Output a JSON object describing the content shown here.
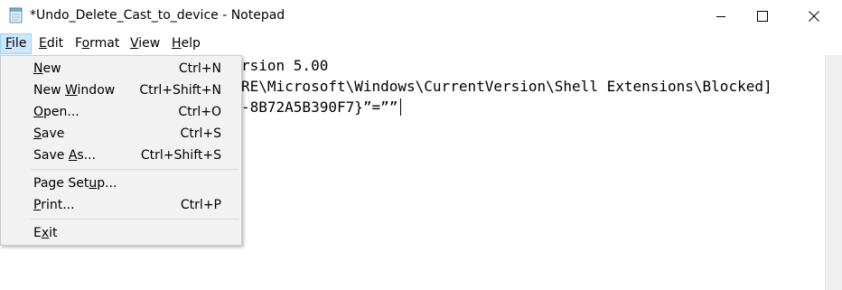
{
  "window": {
    "title": "*Undo_Delete_Cast_to_device - Notepad"
  },
  "controls": {
    "minimize_icon": "minimize-icon",
    "maximize_icon": "maximize-icon",
    "close_icon": "close-icon"
  },
  "menubar": {
    "file": {
      "underlined": "F",
      "rest": "ile"
    },
    "edit": {
      "underlined": "E",
      "rest": "dit"
    },
    "format": {
      "pre": "F",
      "underlined": "o",
      "rest": "rmat"
    },
    "view": {
      "underlined": "V",
      "rest": "iew"
    },
    "help": {
      "underlined": "H",
      "rest": "elp"
    }
  },
  "file_menu": {
    "new": {
      "underlined": "N",
      "rest": "ew",
      "shortcut": "Ctrl+N"
    },
    "new_window": {
      "pre": "New ",
      "underlined": "W",
      "rest": "indow",
      "shortcut": "Ctrl+Shift+N"
    },
    "open": {
      "underlined": "O",
      "rest": "pen...",
      "shortcut": "Ctrl+O"
    },
    "save": {
      "underlined": "S",
      "rest": "ave",
      "shortcut": "Ctrl+S"
    },
    "save_as": {
      "pre": "Save ",
      "underlined": "A",
      "rest": "s...",
      "shortcut": "Ctrl+Shift+S"
    },
    "page_setup": {
      "pre": "Page Set",
      "underlined": "u",
      "rest": "p..."
    },
    "print": {
      "underlined": "P",
      "rest": "rint...",
      "shortcut": "Ctrl+P"
    },
    "exit": {
      "pre": "E",
      "underlined": "x",
      "rest": "it"
    }
  },
  "editor": {
    "line1": "rsion 5.00",
    "line2": "RE\\Microsoft\\Windows\\CurrentVersion\\Shell Extensions\\Blocked]",
    "line3": "-8B72A5B390F7}”=””"
  }
}
